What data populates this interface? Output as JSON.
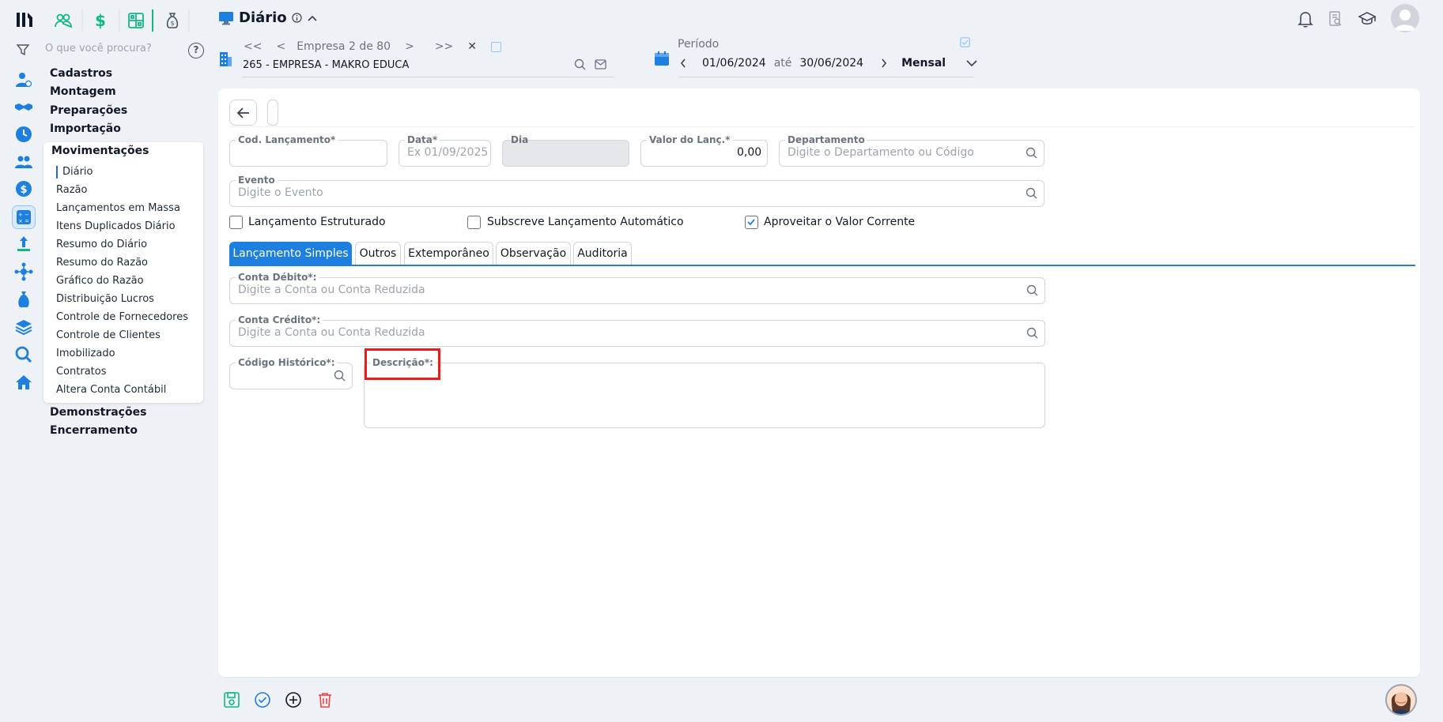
{
  "header": {
    "page_title": "Diário",
    "search_placeholder": "O que você procura?",
    "help_label": "?"
  },
  "empresa": {
    "nav_first": "<<",
    "nav_prev": "<",
    "counter": "Empresa 2 de 80",
    "nav_next": ">",
    "nav_last": ">>",
    "close": "✕",
    "name": "265 - EMPRESA - MAKRO EDUCA"
  },
  "periodo": {
    "label": "Período",
    "start": "01/06/2024",
    "sep": "até",
    "end": "30/06/2024",
    "mode": "Mensal"
  },
  "menu": {
    "groups_top": [
      "Cadastros",
      "Montagem",
      "Preparações",
      "Importação"
    ],
    "active_group": "Movimentações",
    "items": [
      "Diário",
      "Razão",
      "Lançamentos em Massa",
      "Itens Duplicados Diário",
      "Resumo do Diário",
      "Resumo do Razão",
      "Gráfico do Razão",
      "Distribuição Lucros",
      "Controle de Fornecedores",
      "Controle de Clientes",
      "Imobilizado",
      "Contratos",
      "Altera Conta Contábil"
    ],
    "groups_bottom": [
      "Demonstrações",
      "Encerramento"
    ]
  },
  "form": {
    "cod_label": "Cod. Lançamento*",
    "data_label": "Data*",
    "data_placeholder": "Ex 01/09/2025",
    "dia_label": "Dia",
    "valor_label": "Valor do Lanç.*",
    "valor_value": "0,00",
    "depto_label": "Departamento",
    "depto_placeholder": "Digite o Departamento ou Código",
    "evento_label": "Evento",
    "evento_placeholder": "Digite o Evento",
    "chk_estruturado": "Lançamento Estruturado",
    "chk_subscreve": "Subscreve Lançamento Automático",
    "chk_aproveitar": "Aproveitar o Valor Corrente",
    "conta_debito_label": "Conta Débito*:",
    "conta_debito_placeholder": "Digite a Conta ou Conta Reduzida",
    "conta_credito_label": "Conta Crédito*:",
    "conta_credito_placeholder": "Digite a Conta ou Conta Reduzida",
    "cod_hist_label": "Código Histórico*:",
    "descricao_label": "Descrição*:"
  },
  "tabs": [
    "Lançamento Simples",
    "Outros",
    "Extemporâneo",
    "Observação",
    "Auditoria"
  ],
  "colors": {
    "accent": "#1d7fe0",
    "green": "#10b981",
    "highlight": "#ef1b1b",
    "danger": "#ef4444"
  }
}
